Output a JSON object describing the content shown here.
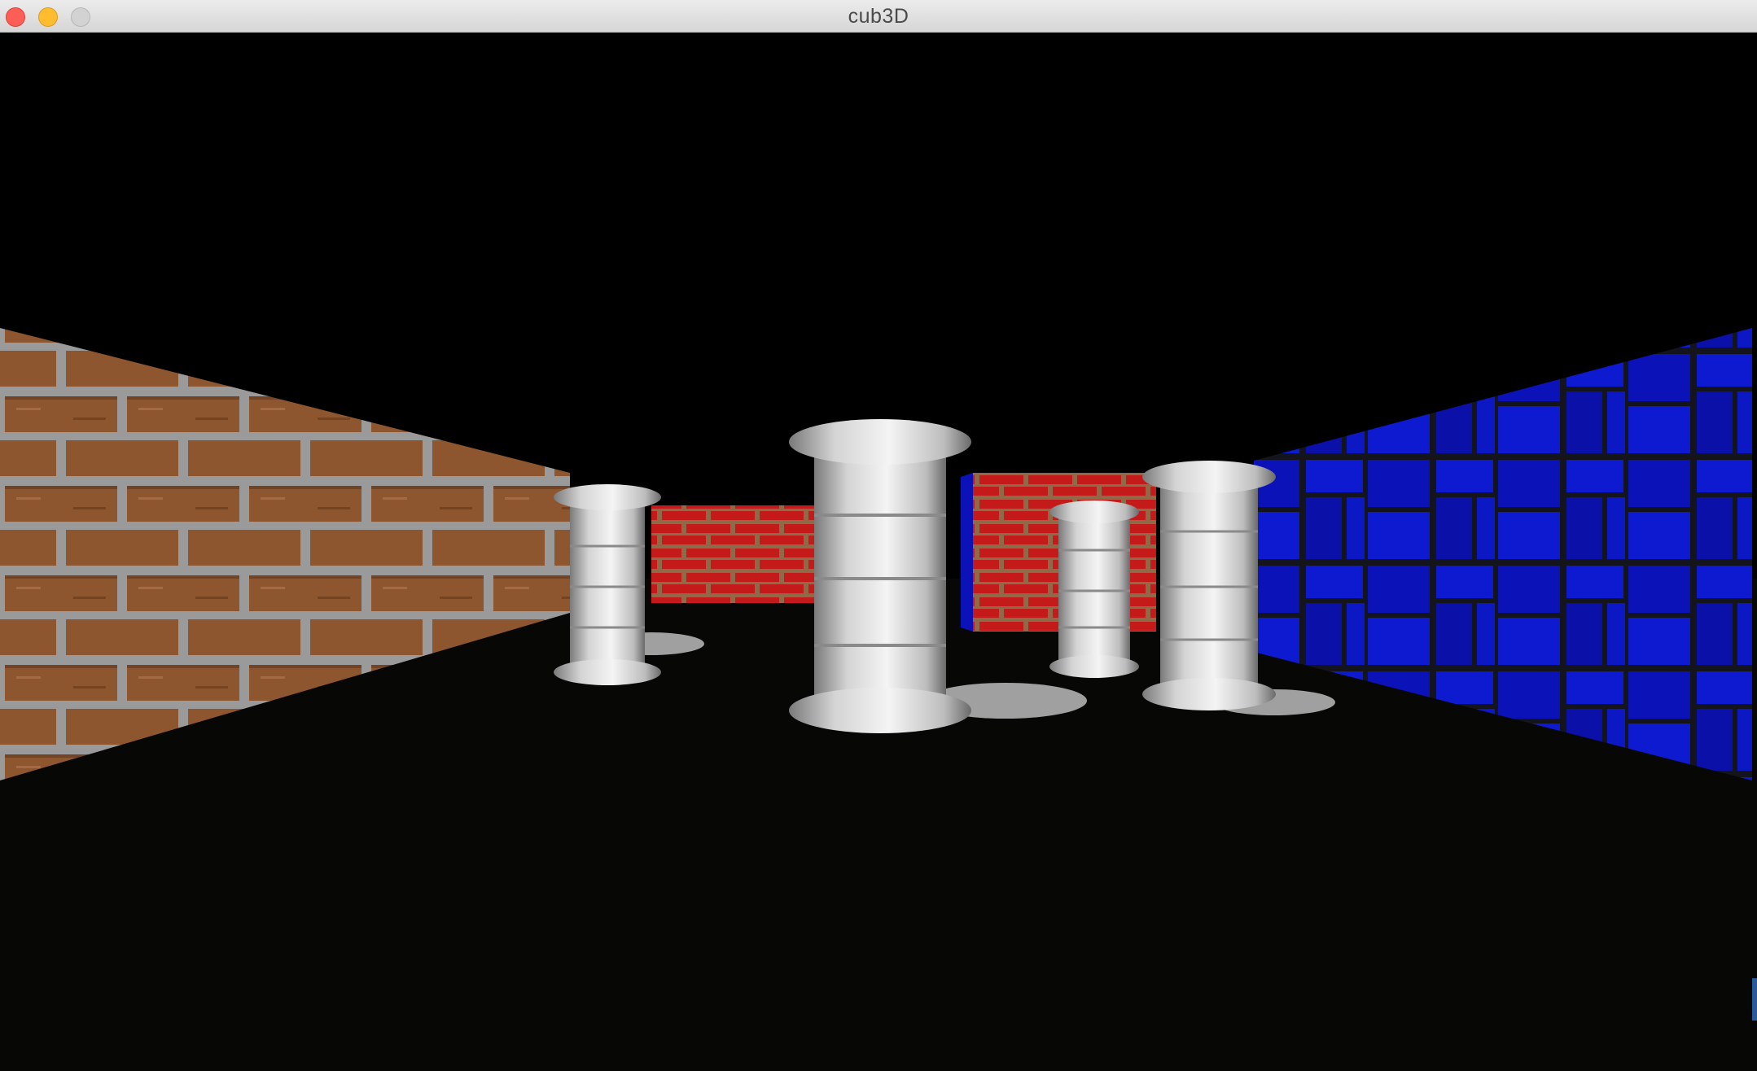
{
  "window": {
    "title": "cub3D",
    "buttons": {
      "close": "close-icon",
      "minimize": "minimize-icon",
      "zoom": "zoom-icon"
    }
  },
  "scene": {
    "ceiling_color": "#000000",
    "floor_color": "#070805",
    "walls": [
      {
        "side": "left",
        "texture": "brown-brick",
        "color": "#9a5e34",
        "mortar": "#a8a8a8"
      },
      {
        "side": "right",
        "texture": "blue-stone",
        "color": "#0a14c8",
        "mortar": "#1a1a20"
      },
      {
        "side": "back",
        "texture": "red-brick",
        "color": "#c01818",
        "mortar": "#9a7050"
      }
    ],
    "sprites": [
      {
        "name": "pillar",
        "count": 4,
        "color": "#d8d8d8"
      }
    ]
  }
}
